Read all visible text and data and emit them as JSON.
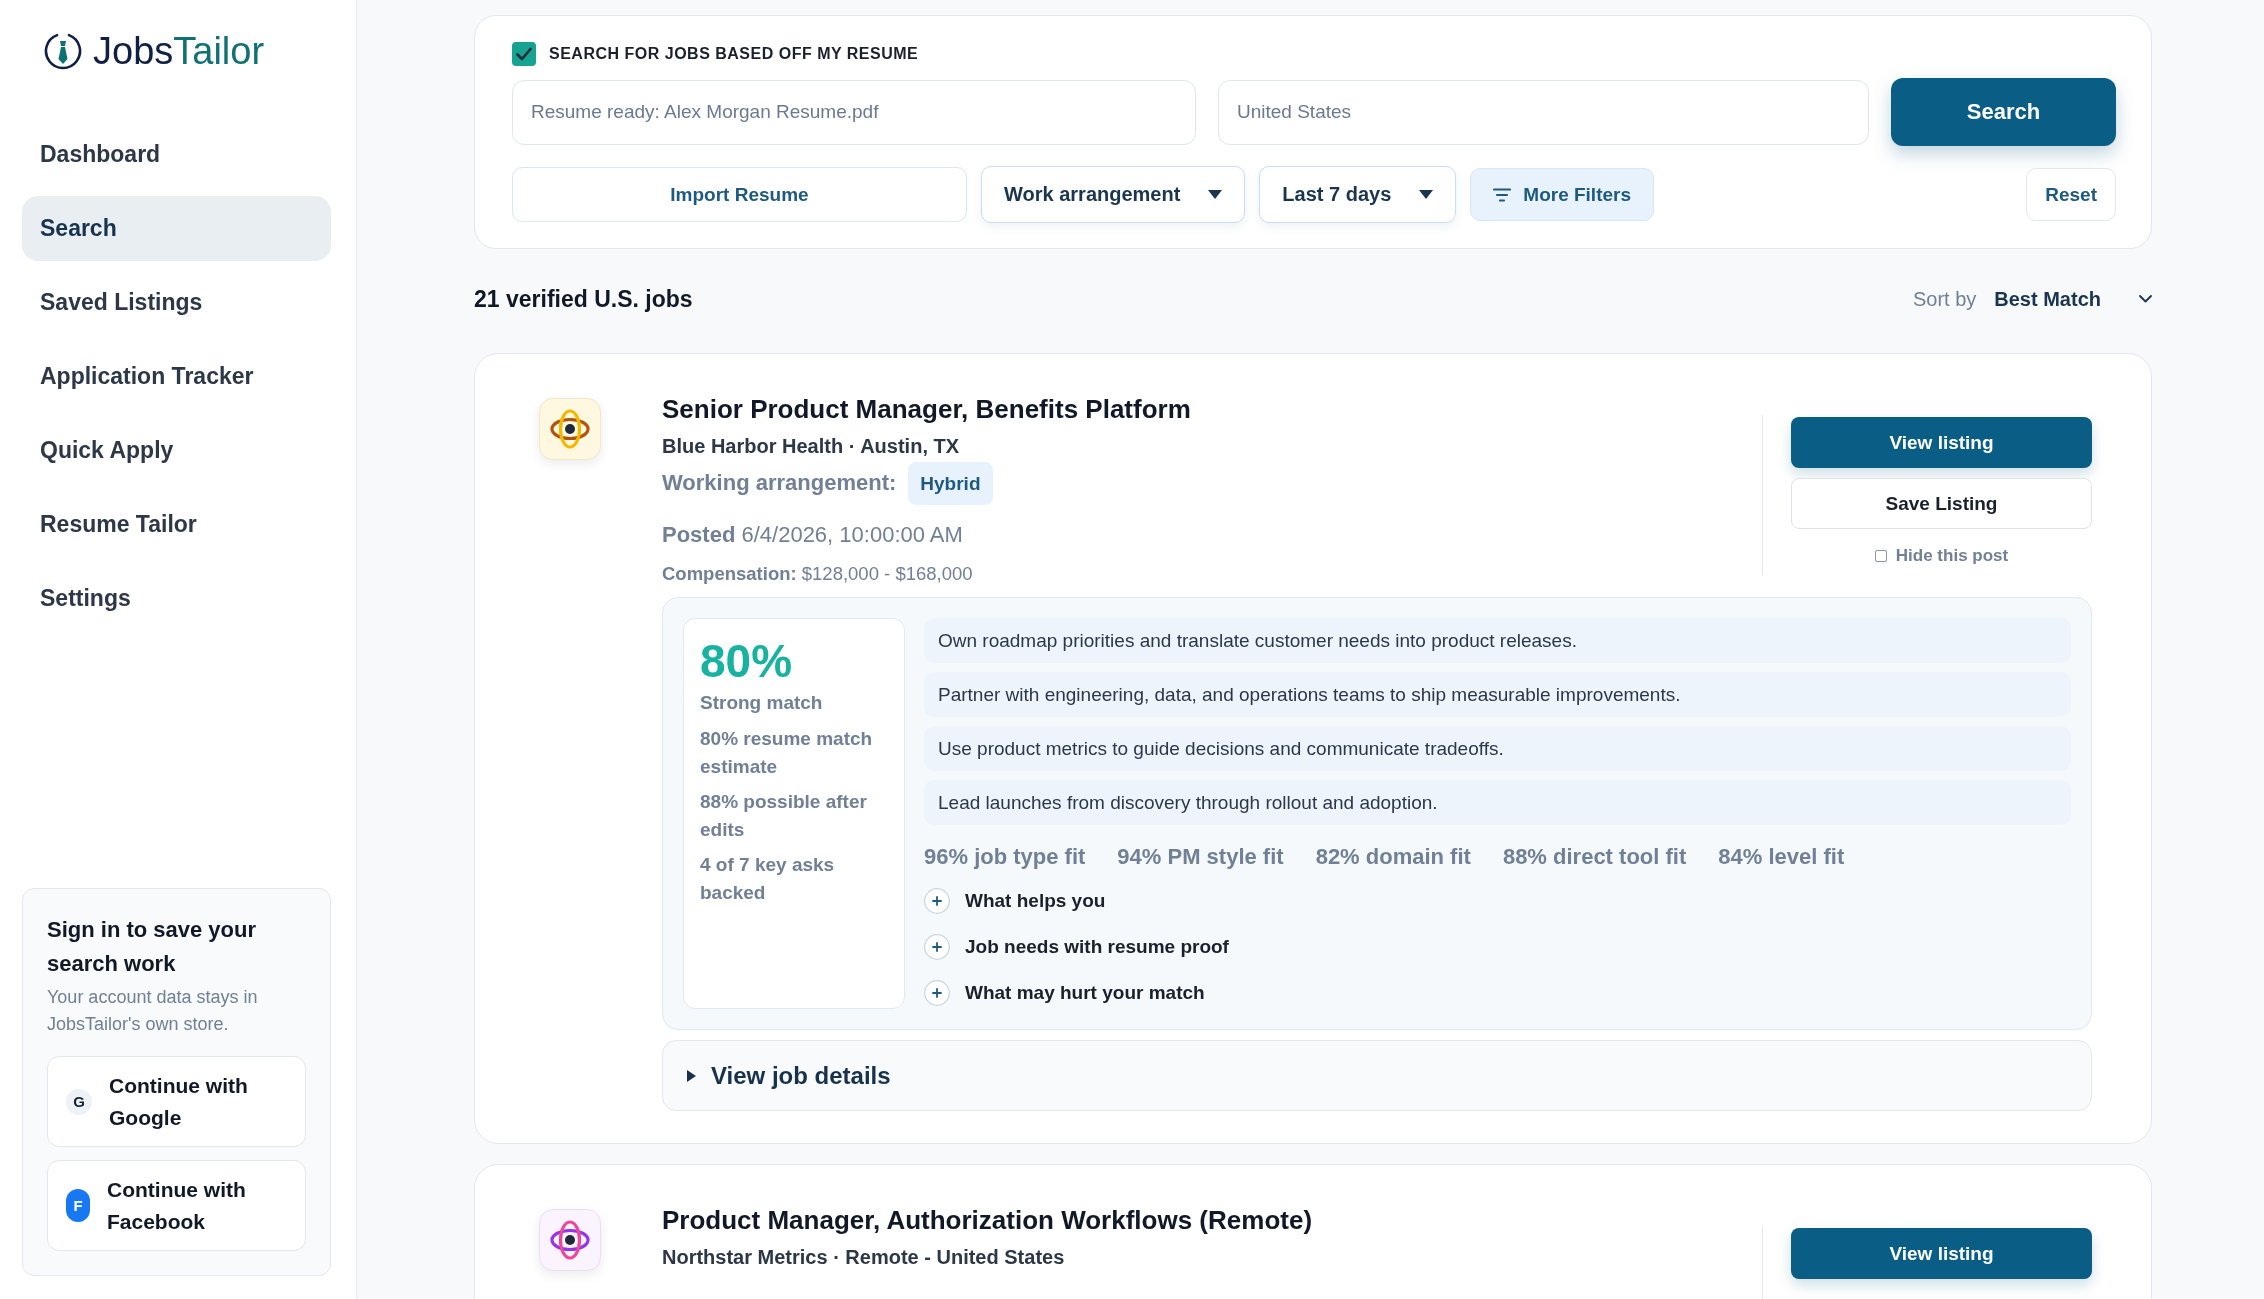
{
  "logo": {
    "text_dark": "Jobs",
    "text_accent": "Tailor"
  },
  "sidebar": {
    "items": [
      {
        "label": "Dashboard",
        "selected": false
      },
      {
        "label": "Search",
        "selected": true
      },
      {
        "label": "Saved Listings",
        "selected": false
      },
      {
        "label": "Application Tracker",
        "selected": false
      },
      {
        "label": "Quick Apply",
        "selected": false
      },
      {
        "label": "Resume Tailor",
        "selected": false
      },
      {
        "label": "Settings",
        "selected": false
      }
    ]
  },
  "sign_in": {
    "title": "Sign in to save your search work",
    "text": "Your account data stays in JobsTailor's own store.",
    "buttons": [
      {
        "kind": "google",
        "initial": "G",
        "label": "Continue with Google"
      },
      {
        "kind": "facebook",
        "initial": "F",
        "label": "Continue with Facebook"
      }
    ]
  },
  "search_panel": {
    "resume_toggle": {
      "label": "SEARCH FOR JOBS BASED OFF MY RESUME",
      "checked": true
    },
    "resume_field": {
      "value": "Resume ready: Alex Morgan Resume.pdf"
    },
    "location_field": {
      "value": "United States"
    },
    "search_button": "Search",
    "filters": [
      {
        "kind": "import",
        "label": "Import Resume"
      },
      {
        "kind": "dropdown",
        "label": "Work arrangement"
      },
      {
        "kind": "dropdown",
        "label": "Last 7 days"
      },
      {
        "kind": "more",
        "label": "More Filters"
      },
      {
        "kind": "reset",
        "label": "Reset"
      }
    ]
  },
  "results": {
    "count": "21 verified U.S. jobs",
    "sort_label": "Sort by",
    "sort_value": "Best Match"
  },
  "jobs": [
    {
      "kind": "amber",
      "title": "Senior Product Manager, Benefits Platform",
      "company": "Blue Harbor Health · Austin, TX",
      "arrangement_label": "Working arrangement:",
      "arrangement": "Hybrid",
      "posted": "**Posted** 6/4/2026, 10:00:00 AM",
      "compensation": "**Compensation:** $128,000 - $168,000",
      "view_button": "View listing",
      "save_button": "Save Listing",
      "hide": {
        "label": "Hide this post",
        "checked": false
      },
      "match": {
        "score": "80%",
        "verdict": "Strong match",
        "notes": [
          "80% resume match estimate",
          "88% possible after edits",
          "4 of 7 key asks backed"
        ]
      },
      "duties": [
        "Own roadmap priorities and translate customer needs into product releases.",
        "Partner with engineering, data, and operations teams to ship measurable improvements.",
        "Use product metrics to guide decisions and communicate tradeoffs.",
        "Lead launches from discovery through rollout and adoption."
      ],
      "fits": [
        "96% job type fit",
        "94% PM style fit",
        "82% domain fit",
        "88% direct tool fit",
        "84% level fit"
      ],
      "sections": [
        {
          "label": "What helps you",
          "expanded": false
        },
        {
          "label": "Job needs with resume proof",
          "expanded": false
        },
        {
          "label": "What may hurt your match",
          "expanded": false
        }
      ],
      "details": {
        "label": "View job details",
        "expanded": false
      }
    },
    {
      "kind": "violet",
      "title": "Product Manager, Authorization Workflows (Remote)",
      "company": "Northstar Metrics · Remote - United States",
      "view_button": "View listing"
    }
  ]
}
